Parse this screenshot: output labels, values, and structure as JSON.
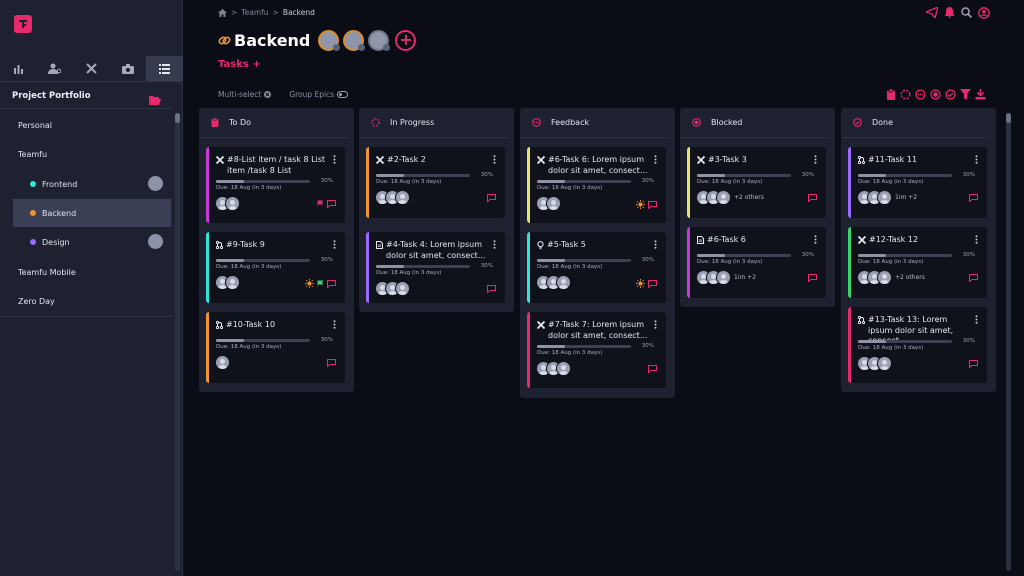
{
  "breadcrumb": {
    "parent": "Teamfu",
    "sep": ">",
    "current": "Backend"
  },
  "header": {
    "title": "Backend",
    "tab": "Tasks",
    "tab_plus": "+",
    "add": "+"
  },
  "options": {
    "multi_select": "Multi-select",
    "group_epics": "Group Epics"
  },
  "sidebar": {
    "portfolio": "Project Portfolio",
    "items": [
      {
        "label": "Personal"
      },
      {
        "label": "Teamfu"
      },
      {
        "label": "Frontend",
        "dot": "#2ee6d6"
      },
      {
        "label": "Backend",
        "dot": "#f0962c"
      },
      {
        "label": "Design",
        "dot": "#9b6bff"
      },
      {
        "label": "Teamfu Mobile"
      },
      {
        "label": "Zero Day"
      }
    ]
  },
  "columns": [
    {
      "title": "To Do",
      "cards": [
        {
          "id": "#8",
          "title": "-List item / task 8 List item /task 8 List",
          "pct": "30%",
          "due": "Due: 18 Aug (in 3 days)",
          "bar": "#c73ad6"
        },
        {
          "id": "#9",
          "title": "-Task 9",
          "pct": "30%",
          "due": "Due: 18 Aug (in 3 days)",
          "bar": "#2ee6d6"
        },
        {
          "id": "#10",
          "title": "-Task 10",
          "pct": "30%",
          "due": "Due: 18 Aug (in 3 days)",
          "bar": "#f0962c"
        }
      ]
    },
    {
      "title": "In Progress",
      "cards": [
        {
          "id": "#2",
          "title": "-Task 2",
          "pct": "30%",
          "due": "Due: 18 Aug (in 3 days)",
          "bar": "#f0962c"
        },
        {
          "id": "#4",
          "title": "-Task 4: Lorem ipsum dolor sit amet, consect...",
          "pct": "30%",
          "due": "Due: 18 Aug (in 3 days)",
          "bar": "#9b6bff"
        }
      ]
    },
    {
      "title": "Feedback",
      "cards": [
        {
          "id": "#6",
          "title": "-Task 6: Lorem ipsum dolor sit amet, consect...",
          "pct": "30%",
          "due": "Due: 18 Aug (in 3 days)",
          "bar": "#e8e36a"
        },
        {
          "id": "#5",
          "title": "-Task 5",
          "pct": "30%",
          "due": "Due: 18 Aug (in 3 days)",
          "bar": "#2ee6d6"
        },
        {
          "id": "#7",
          "title": "-Task 7: Lorem ipsum dolor sit amet, consect...",
          "pct": "30%",
          "due": "Due: 18 Aug (in 3 days)",
          "bar": "#e8296b"
        }
      ]
    },
    {
      "title": "Blocked",
      "cards": [
        {
          "id": "#3",
          "title": "-Task 3",
          "pct": "30%",
          "due": "Due: 18 Aug (in 3 days)",
          "bar": "#e8e36a",
          "extra": "+2 others"
        },
        {
          "id": "#6",
          "title": "-Task 6",
          "pct": "30%",
          "due": "Due: 18 Aug (in 3 days)",
          "bar": "#c73ad6",
          "extra": "1im +2"
        }
      ]
    },
    {
      "title": "Done",
      "cards": [
        {
          "id": "#11",
          "title": "-Task 11",
          "pct": "30%",
          "due": "Due: 18 Aug (in 3 days)",
          "bar": "#9b6bff",
          "extra": "1im +2"
        },
        {
          "id": "#12",
          "title": "-Task 12",
          "pct": "30%",
          "due": "Due: 18 Aug (in 3 days)",
          "bar": "#38d66b",
          "extra": "+2 others"
        },
        {
          "id": "#13",
          "title": "-Task 13: Lorem ipsum dolor sit amet, consect...",
          "pct": "30%",
          "due": "Due: 18 Aug (in 3 days)",
          "bar": "#e8296b"
        }
      ]
    }
  ],
  "icons": {
    "accent": "#e8296b",
    "attention": "#f0962c",
    "flag_green": "#38d66b"
  }
}
